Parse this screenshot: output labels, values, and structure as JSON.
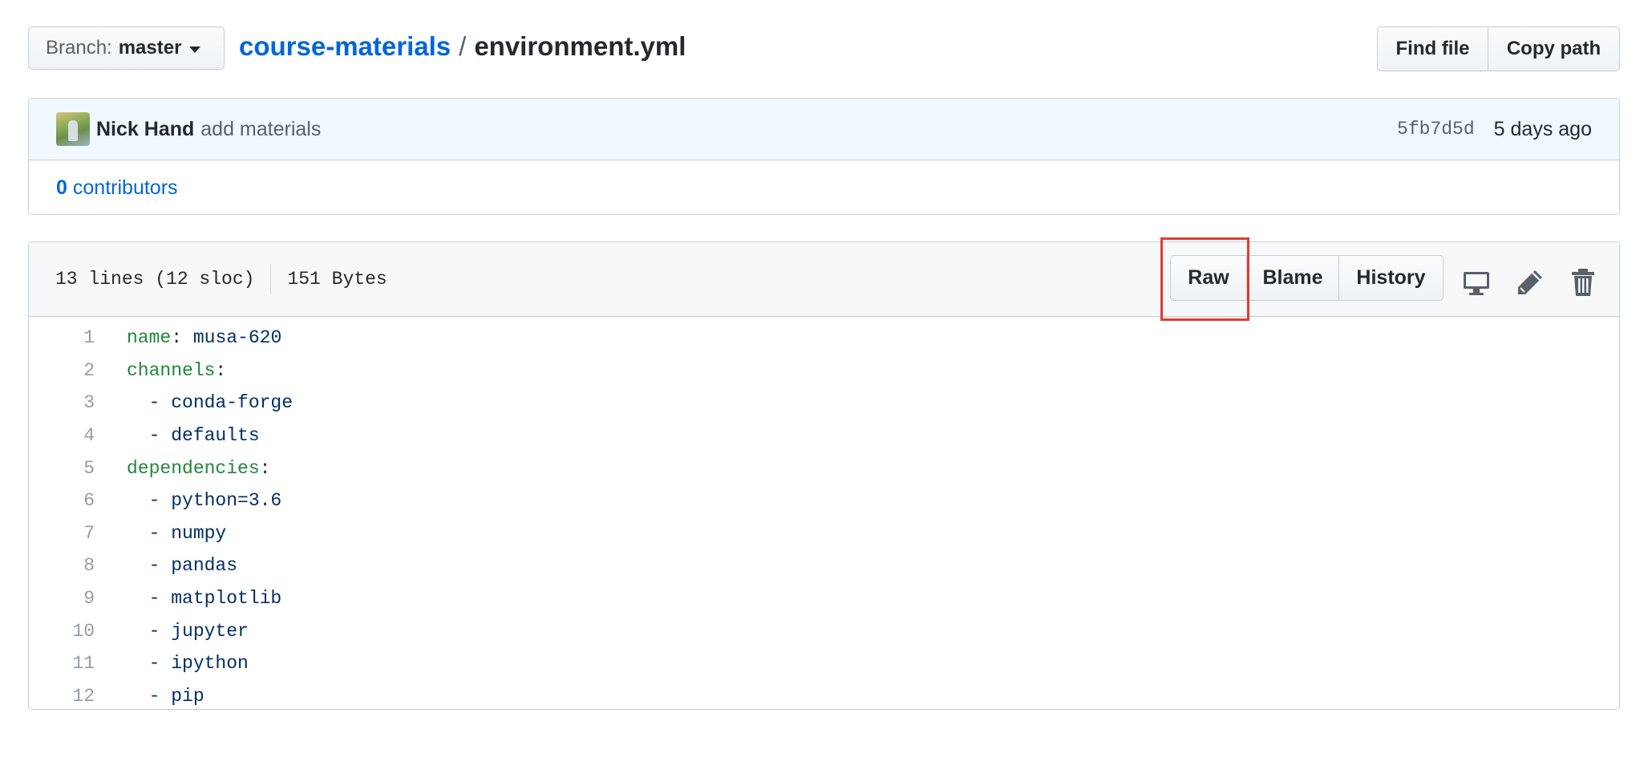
{
  "branch": {
    "label": "Branch:",
    "value": "master"
  },
  "breadcrumb": {
    "repo": "course-materials",
    "separator": "/",
    "file": "environment.yml"
  },
  "file_nav": {
    "find_file": "Find file",
    "copy_path": "Copy path"
  },
  "commit": {
    "author": "Nick Hand",
    "message": "add materials",
    "sha": "5fb7d5d",
    "time": "5 days ago",
    "contributors_count": "0",
    "contributors_label": "contributors"
  },
  "file": {
    "lines_info": "13 lines (12 sloc)",
    "size": "151 Bytes",
    "actions": {
      "raw": "Raw",
      "blame": "Blame",
      "history": "History"
    },
    "icons": [
      "desktop-icon",
      "pencil-icon",
      "trash-icon"
    ]
  },
  "code_lines": [
    {
      "n": "1",
      "key": "name",
      "colon": ":",
      "value": " musa-620"
    },
    {
      "n": "2",
      "key": "channels",
      "colon": ":",
      "value": ""
    },
    {
      "n": "3",
      "key": "",
      "colon": "",
      "value": "  - conda-forge"
    },
    {
      "n": "4",
      "key": "",
      "colon": "",
      "value": "  - defaults"
    },
    {
      "n": "5",
      "key": "dependencies",
      "colon": ":",
      "value": ""
    },
    {
      "n": "6",
      "key": "",
      "colon": "",
      "value": "  - python=3.6"
    },
    {
      "n": "7",
      "key": "",
      "colon": "",
      "value": "  - numpy"
    },
    {
      "n": "8",
      "key": "",
      "colon": "",
      "value": "  - pandas"
    },
    {
      "n": "9",
      "key": "",
      "colon": "",
      "value": "  - matplotlib"
    },
    {
      "n": "10",
      "key": "",
      "colon": "",
      "value": "  - jupyter"
    },
    {
      "n": "11",
      "key": "",
      "colon": "",
      "value": "  - ipython"
    },
    {
      "n": "12",
      "key": "",
      "colon": "",
      "value": "  - pip"
    }
  ],
  "colors": {
    "link": "#0366d6",
    "yaml_key": "#22863a",
    "yaml_value": "#032f62",
    "highlight": "#e53a2f"
  }
}
